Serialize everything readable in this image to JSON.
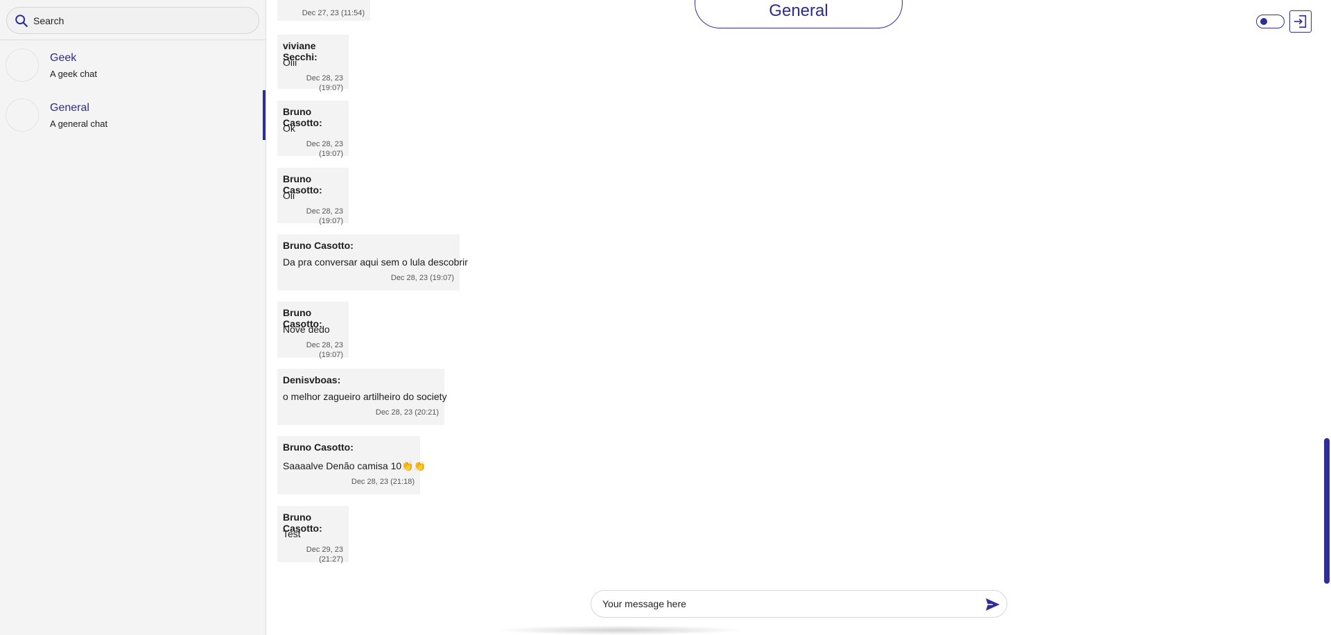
{
  "sidebar": {
    "search": {
      "placeholder": "Search",
      "value": ""
    },
    "chats": [
      {
        "name": "Geek",
        "description": "A geek chat",
        "active": false
      },
      {
        "name": "General",
        "description": "A general chat",
        "active": true
      }
    ]
  },
  "header": {
    "title": "General",
    "theme_toggle": "dark-mode-toggle",
    "logout_icon": "logout-icon"
  },
  "messages": [
    {
      "sender": "",
      "text": "",
      "time": "Dec 27, 23 (11:54)"
    },
    {
      "sender": "viviane Secchi:",
      "text": "Oiii",
      "time": "Dec 28, 23 (19:07)"
    },
    {
      "sender": "Bruno Casotto:",
      "text": "Ok",
      "time": "Dec 28, 23 (19:07)"
    },
    {
      "sender": "Bruno Casotto:",
      "text": "Oii",
      "time": "Dec 28, 23 (19:07)"
    },
    {
      "sender": "Bruno Casotto:",
      "text": "Da pra conversar aqui sem o lula descobrir",
      "time": "Dec 28, 23 (19:07)"
    },
    {
      "sender": "Bruno Casotto:",
      "text": "Nove dedo",
      "time": "Dec 28, 23 (19:07)"
    },
    {
      "sender": "Denisvboas:",
      "text": "o melhor zagueiro artilheiro do society",
      "time": "Dec 28, 23 (20:21)"
    },
    {
      "sender": "Bruno Casotto:",
      "text": "Saaaalve Denão camisa 10👏👏",
      "time": "Dec 28, 23 (21:18)"
    },
    {
      "sender": "Bruno Casotto:",
      "text": "Test",
      "time": "Dec 29, 23 (21:27)"
    }
  ],
  "composer": {
    "placeholder": "Your message here",
    "value": "",
    "send_icon": "send-icon"
  },
  "colors": {
    "accent": "#2e2e9a",
    "bubble": "#f3f3f3",
    "sidebar_bg": "#f4f4f4"
  }
}
